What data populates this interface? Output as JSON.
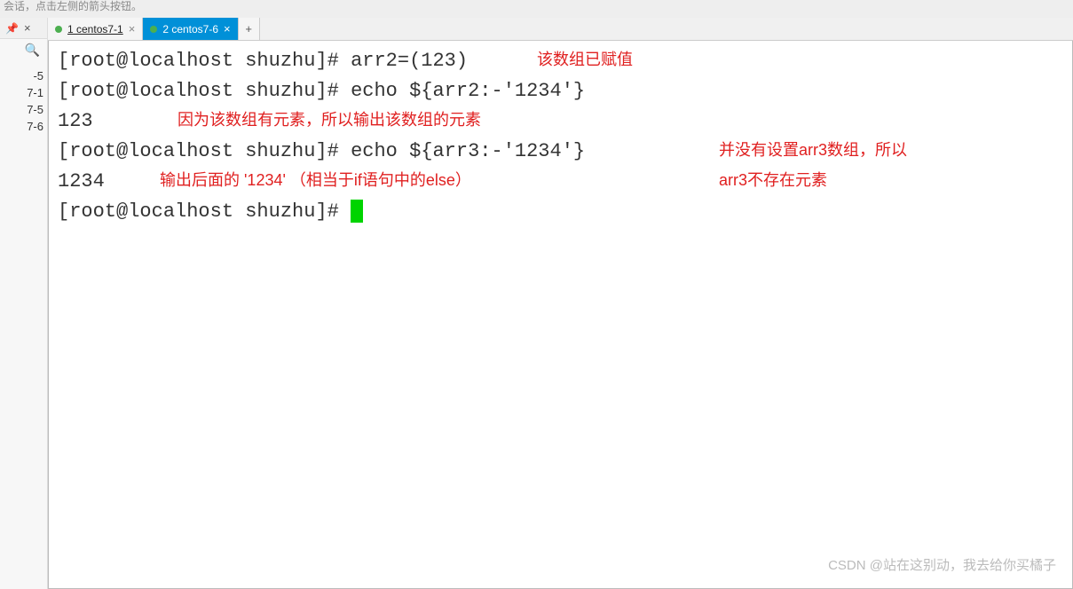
{
  "top_hint": "会话，点击左侧的箭头按钮。",
  "sidebar": {
    "items": [
      "-5",
      "7-1",
      "7-5",
      "7-6"
    ]
  },
  "tabs": [
    {
      "label": "1 centos7-1",
      "active": false
    },
    {
      "label": "2 centos7-6",
      "active": true
    }
  ],
  "terminal": {
    "prompt": "[root@localhost shuzhu]# ",
    "lines": [
      {
        "cmd": "arr2=(123)"
      },
      {
        "cmd": "echo ${arr2:-'1234'}"
      },
      {
        "out": "123"
      },
      {
        "cmd": "echo ${arr3:-'1234'}"
      },
      {
        "out": "1234"
      },
      {
        "cmd": ""
      }
    ]
  },
  "annotations": {
    "a1": "该数组已赋值",
    "a2": "因为该数组有元素，所以输出该数组的元素",
    "a3_line1": "并没有设置arr3数组，所以",
    "a3_line2": "arr3不存在元素",
    "a4": "输出后面的 '1234'   （相当于if语句中的else）"
  },
  "watermark": "CSDN @站在这别动，我去给你买橘子"
}
